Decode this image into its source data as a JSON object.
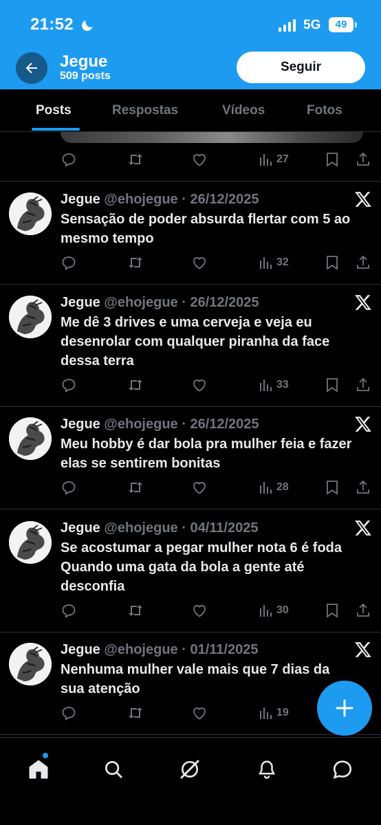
{
  "status_bar": {
    "time": "21:52",
    "network": "5G",
    "battery": "49",
    "icons": [
      "moon-icon",
      "signal-icon"
    ]
  },
  "header": {
    "name": "Jegue",
    "posts_count": "509 posts",
    "follow_label": "Seguir"
  },
  "tabs": [
    {
      "label": "Posts",
      "active": true
    },
    {
      "label": "Respostas",
      "active": false
    },
    {
      "label": "Vídeos",
      "active": false
    },
    {
      "label": "Fotos",
      "active": false
    }
  ],
  "top_partial_post": {
    "views": "27"
  },
  "posts": [
    {
      "name": "Jegue",
      "handle": "@ehojegue",
      "date": "26/12/2025",
      "text": "Sensação de poder absurda flertar com 5 ao\nmesmo tempo",
      "views": "32"
    },
    {
      "name": "Jegue",
      "handle": "@ehojegue",
      "date": "26/12/2025",
      "text": "Me dê 3 drives e uma cerveja e veja eu\ndesenrolar com qualquer piranha da face\ndessa terra",
      "views": "33"
    },
    {
      "name": "Jegue",
      "handle": "@ehojegue",
      "date": "26/12/2025",
      "text": "Meu hobby é dar bola pra mulher feia e fazer\nelas se sentirem bonitas",
      "views": "28"
    },
    {
      "name": "Jegue",
      "handle": "@ehojegue",
      "date": "04/11/2025",
      "text": "Se acostumar a pegar mulher nota 6 é foda\nQuando uma gata da bola a gente até\ndesconfia",
      "views": "30"
    },
    {
      "name": "Jegue",
      "handle": "@ehojegue",
      "date": "01/11/2025",
      "text": "Nenhuma mulher vale mais que 7 dias da\nsua atenção",
      "views": "19"
    }
  ],
  "bottom_nav": [
    "home-icon",
    "search-icon",
    "grok-icon",
    "notifications-icon",
    "messages-icon"
  ],
  "colors": {
    "accent": "#1d9bf0",
    "background": "#000000",
    "text": "#e7e9ea",
    "muted": "#71767b"
  }
}
